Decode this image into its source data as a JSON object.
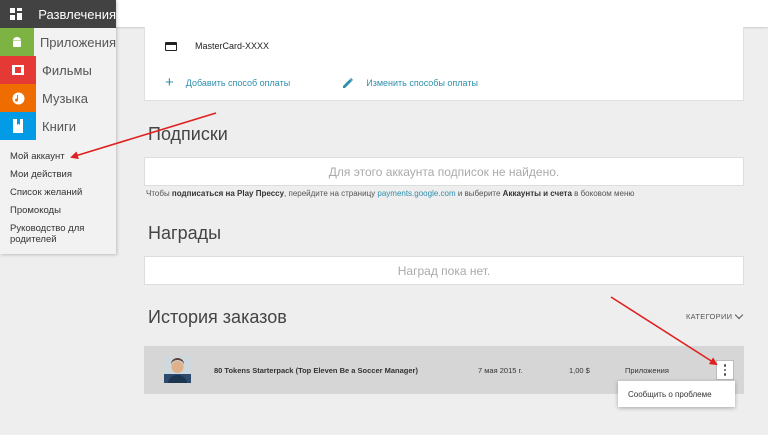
{
  "sidebar": {
    "entertainment_label": "Развлечения",
    "categories": [
      {
        "label": "Приложения",
        "color": "#7cb342",
        "icon": "android-icon"
      },
      {
        "label": "Фильмы",
        "color": "#e53935",
        "icon": "film-icon"
      },
      {
        "label": "Музыка",
        "color": "#ef6c00",
        "icon": "music-icon"
      },
      {
        "label": "Книги",
        "color": "#039be5",
        "icon": "book-icon"
      }
    ],
    "links": [
      "Мой аккаунт",
      "Мои действия",
      "Список желаний",
      "Промокоды",
      "Руководство для родителей"
    ]
  },
  "payment": {
    "card_label": "MasterCard-XXXX",
    "add_label": "Добавить способ оплаты",
    "edit_label": "Изменить способы оплаты"
  },
  "subscriptions": {
    "title": "Подписки",
    "empty_text": "Для этого аккаунта подписок не найдено.",
    "note_prefix": "Чтобы ",
    "note_bold1": "подписаться на Play Прессу",
    "note_mid": ", перейдите на страницу ",
    "note_link": "payments.google.com",
    "note_mid2": " и выберите ",
    "note_bold2": "Аккаунты и счета",
    "note_suffix": " в боковом меню"
  },
  "rewards": {
    "title": "Награды",
    "empty_text": "Наград пока нет."
  },
  "orders": {
    "title": "История заказов",
    "categories_label": "КАТЕГОРИИ",
    "items": [
      {
        "title": "80 Tokens Starterpack (Top Eleven Be a Soccer Manager)",
        "date": "7 мая 2015 г.",
        "price": "1,00 $",
        "category": "Приложения"
      }
    ],
    "menu_item": "Сообщить о проблеме"
  },
  "colors": {
    "accent": "#2e8fae",
    "annotation_arrow": "#e02020"
  }
}
